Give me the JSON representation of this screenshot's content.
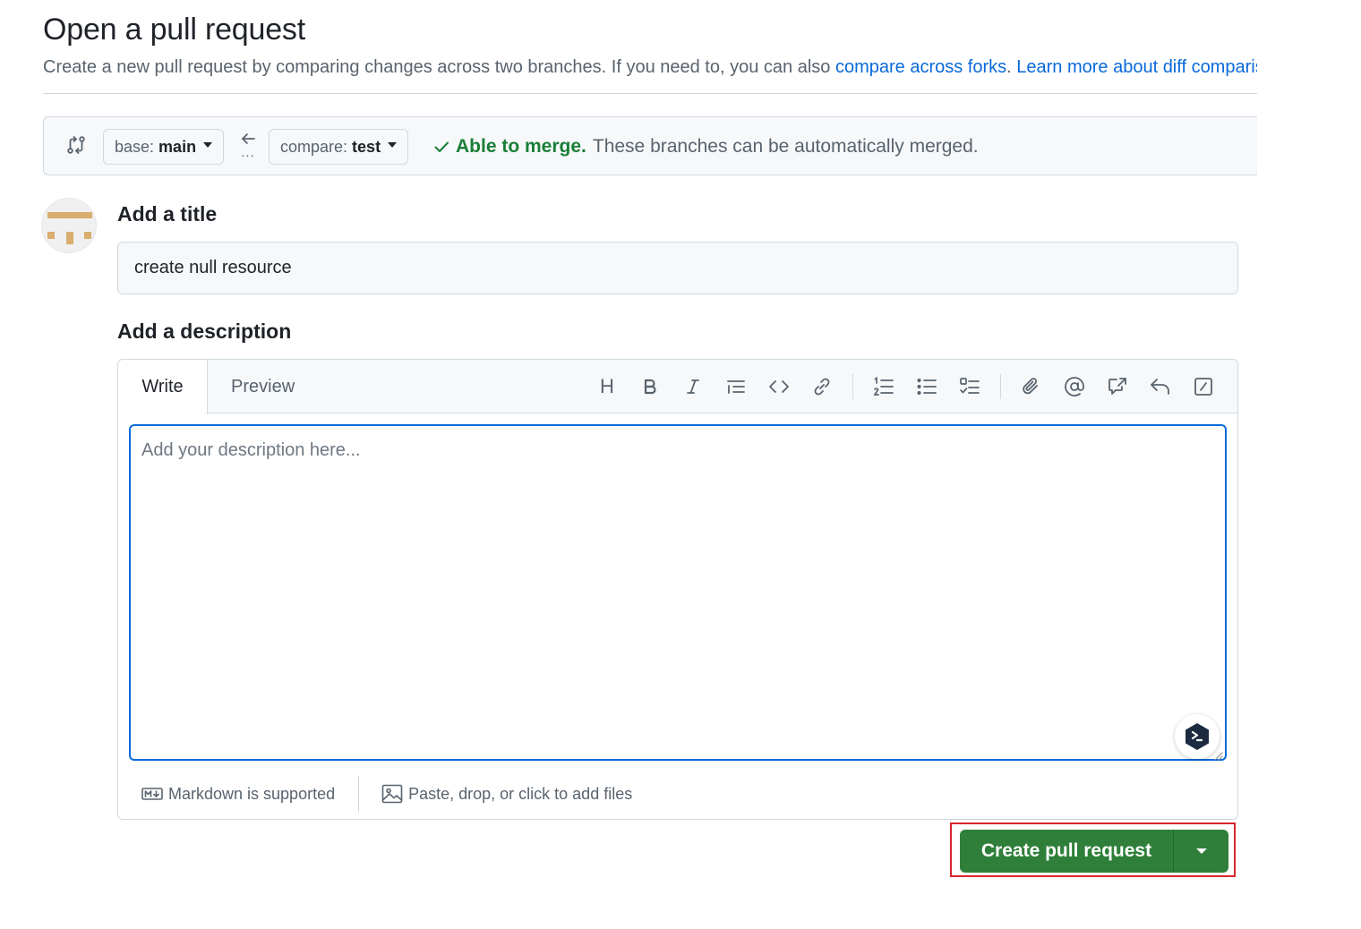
{
  "page": {
    "title": "Open a pull request",
    "subtitle_text": "Create a new pull request by comparing changes across two branches. If you need to, you can also ",
    "compare_forks_link": "compare across forks",
    "separator": ". ",
    "learn_more_link": "Learn more about diff comparisons here."
  },
  "range": {
    "base_prefix": "base:",
    "base_branch": "main",
    "compare_prefix": "compare:",
    "compare_branch": "test",
    "merge_ok": "Able to merge.",
    "merge_message": "These branches can be automatically merged."
  },
  "form": {
    "title_label": "Add a title",
    "title_value": "create null resource",
    "description_label": "Add a description",
    "description_placeholder": "Add your description here..."
  },
  "editor": {
    "tab_write": "Write",
    "tab_preview": "Preview",
    "markdown_note": "Markdown is supported",
    "files_note": "Paste, drop, or click to add files",
    "heading_glyph": "H"
  },
  "actions": {
    "create_label": "Create pull request"
  },
  "colors": {
    "accent_link": "#0969da",
    "success": "#1a7f37",
    "primary_button": "#2f7f3a",
    "highlight_border": "#d7262e"
  },
  "icons": {
    "compare": "git-compare-icon",
    "arrow": "arrow-left-icon",
    "check": "check-icon",
    "avatar": "identicon-avatar",
    "toolbar": [
      "heading-icon",
      "bold-icon",
      "italic-icon",
      "quote-icon",
      "code-icon",
      "link-icon",
      "ordered-list-icon",
      "unordered-list-icon",
      "task-list-icon",
      "attach-icon",
      "mention-icon",
      "cross-reference-icon",
      "reply-icon",
      "slash-command-icon"
    ],
    "markdown": "markdown-icon",
    "image": "image-icon",
    "assistant": "assistant-icon"
  }
}
